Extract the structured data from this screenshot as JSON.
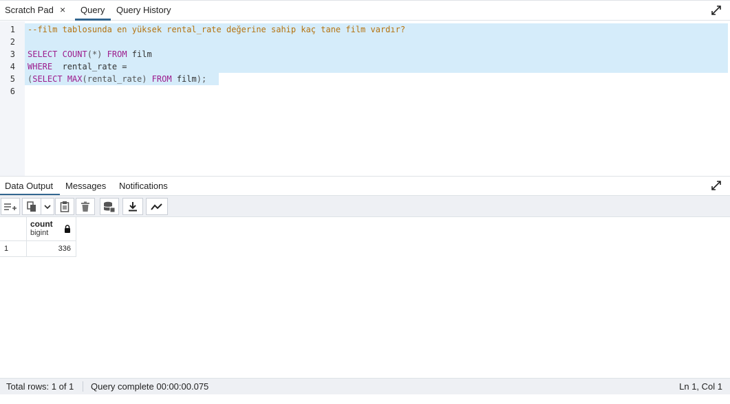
{
  "top_tabs": {
    "scratch_pad": "Scratch Pad",
    "close_symbol": "×",
    "query": "Query",
    "query_history": "Query History"
  },
  "editor": {
    "line_numbers": [
      "1",
      "2",
      "3",
      "4",
      "5",
      "6"
    ],
    "lines": {
      "l1_comment": "--film tablosunda en yüksek rental_rate değerine sahip kaç tane film vardır?",
      "l3_select": "SELECT",
      "l3_count": "COUNT",
      "l3_star": "(*)",
      "l3_from": "FROM",
      "l3_table": "film",
      "l4_where": "WHERE",
      "l4_rest": "rental_rate =",
      "l5_open": "(",
      "l5_select": "SELECT",
      "l5_max": "MAX",
      "l5_arg": "(rental_rate)",
      "l5_from": "FROM",
      "l5_table": "film",
      "l5_close": ");"
    },
    "selected_lines": [
      1,
      2,
      3,
      4,
      5
    ],
    "colors": {
      "comment": "#b5730f",
      "keyword": "#9d1d8d",
      "selection": "#d5ecfa"
    }
  },
  "data_tabs": {
    "data_output": "Data Output",
    "messages": "Messages",
    "notifications": "Notifications"
  },
  "toolbar": {
    "icons": [
      "add-row-icon",
      "copy-icon",
      "copy-options-chevron-icon",
      "paste-icon",
      "delete-icon",
      "save-data-icon",
      "download-icon",
      "graph-visualiser-icon"
    ]
  },
  "result_grid": {
    "column": {
      "name": "count",
      "type": "bigint",
      "lock_icon": "lock-icon"
    },
    "rows": [
      {
        "num": "1",
        "value": "336"
      }
    ]
  },
  "status": {
    "total_rows": "Total rows: 1 of 1",
    "query_complete": "Query complete 00:00:00.075",
    "cursor": "Ln 1, Col 1"
  }
}
